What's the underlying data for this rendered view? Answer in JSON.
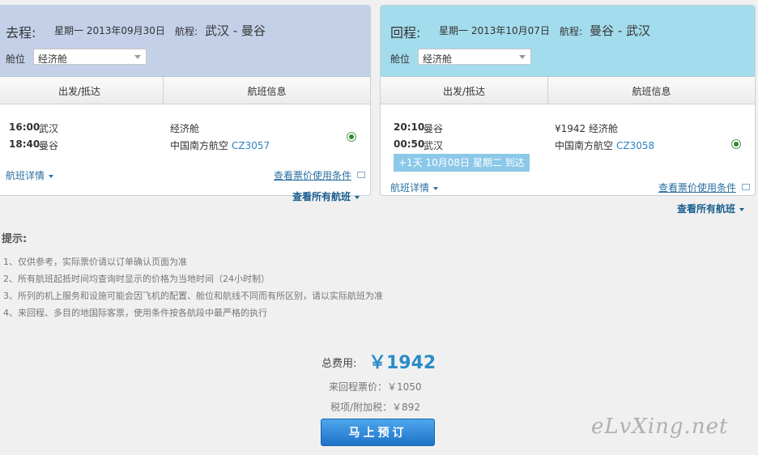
{
  "outbound": {
    "leg_label": "去程:",
    "date": "星期一 2013年09月30日",
    "route_label": "航程:",
    "route": "武汉 - 曼谷",
    "cabin_label": "舱位",
    "cabin_value": "经济舱",
    "col_depart_arrive": "出发/抵达",
    "col_flight_info": "航班信息",
    "depart_time": "16:00",
    "depart_city": "武汉",
    "arrive_time": "18:40",
    "arrive_city": "曼谷",
    "fare": "经济舱",
    "airline": "中国南方航空",
    "flight_no": "CZ3057",
    "details_link": "航班详情",
    "rules_link": "查看票价使用条件",
    "all_flights_link": "查看所有航班"
  },
  "return": {
    "leg_label": "回程:",
    "date": "星期一 2013年10月07日",
    "route_label": "航程:",
    "route": "曼谷 - 武汉",
    "cabin_label": "舱位",
    "cabin_value": "经济舱",
    "col_depart_arrive": "出发/抵达",
    "col_flight_info": "航班信息",
    "depart_time": "20:10",
    "depart_city": "曼谷",
    "arrive_time": "00:50",
    "arrive_city": "武汉",
    "fare": "¥1942 经济舱",
    "airline": "中国南方航空",
    "flight_no": "CZ3058",
    "next_day_notice": "+1天 10月08日 星期二 到达",
    "details_link": "航班详情",
    "rules_link": "查看票价使用条件",
    "all_flights_link": "查看所有航班"
  },
  "tips": {
    "title": "提示:",
    "items": [
      "1、仅供参考，实际票价请以订单确认页面为准",
      "2、所有航班起抵时间均查询时显示的价格为当地时间（24小时制）",
      "3、所列的机上服务和设施可能会因飞机的配置、舱位和航线不同而有所区别，请以实际航班为准",
      "4、来回程、多目的地国际客票，使用条件按各航段中最严格的执行"
    ]
  },
  "summary": {
    "total_label": "总费用:",
    "total_amount": "￥1942",
    "round_trip_fare": "来回程票价：￥1050",
    "taxes": "税项/附加税：￥892",
    "book_button": "马上预订"
  },
  "watermark": "eLvXing.net",
  "colors": {
    "outbound_header": "#c3d0e8",
    "return_header": "#a3dcec",
    "link": "#2a6fa0",
    "price": "#2a8cc8",
    "button": "#1e72c8"
  }
}
